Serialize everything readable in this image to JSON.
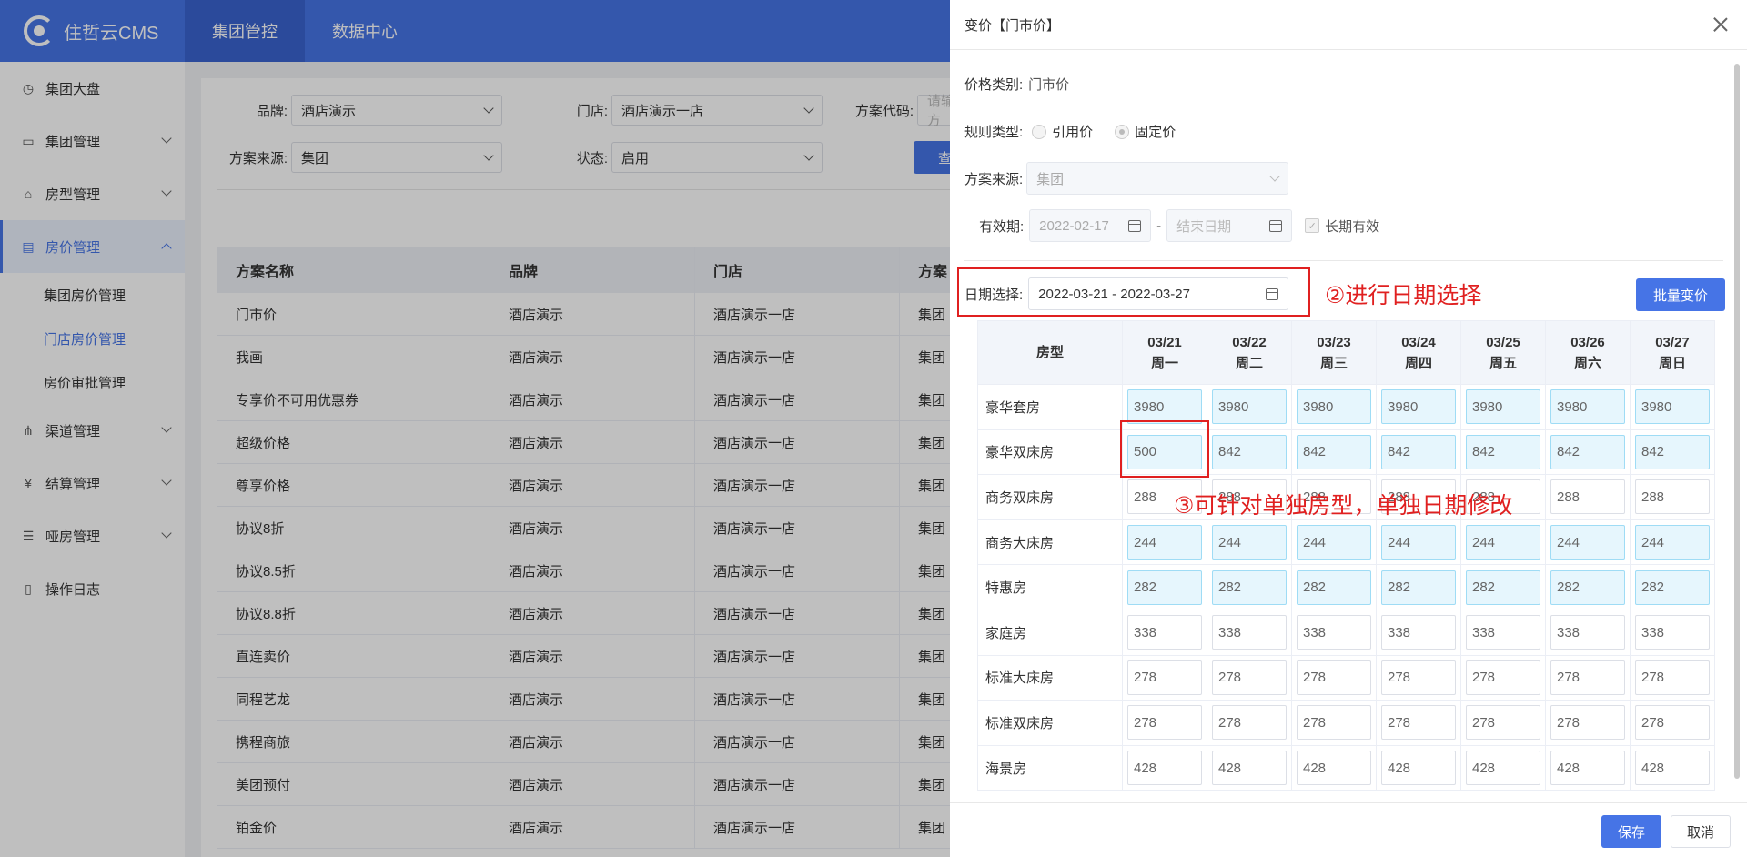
{
  "app": {
    "logo_text": "住哲云CMS"
  },
  "topnav": [
    {
      "label": "集团管控",
      "active": true
    },
    {
      "label": "数据中心",
      "active": false
    }
  ],
  "sidebar": {
    "items": [
      {
        "label": "集团大盘",
        "icon": "clock-icon"
      },
      {
        "label": "集团管理",
        "icon": "monitor-icon"
      },
      {
        "label": "房型管理",
        "icon": "building-icon"
      },
      {
        "label": "房价管理",
        "icon": "price-icon"
      },
      {
        "label": "渠道管理",
        "icon": "network-icon"
      },
      {
        "label": "结算管理",
        "icon": "yen-icon"
      },
      {
        "label": "哑房管理",
        "icon": "list-icon"
      },
      {
        "label": "操作日志",
        "icon": "document-icon"
      }
    ],
    "sub": [
      "集团房价管理",
      "门店房价管理",
      "房价审批管理"
    ]
  },
  "filters": {
    "brand_label": "品牌:",
    "brand_value": "酒店演示",
    "store_label": "门店:",
    "store_value": "酒店演示一店",
    "code_label": "方案代码:",
    "code_placeholder": "请输入方",
    "source_label": "方案来源:",
    "source_value": "集团",
    "status_label": "状态:",
    "status_value": "启用",
    "query_label": "查询"
  },
  "table": {
    "headers": [
      "方案名称",
      "品牌",
      "门店",
      "方案"
    ],
    "rows": [
      [
        "门市价",
        "酒店演示",
        "酒店演示一店",
        "集团"
      ],
      [
        "我画",
        "酒店演示",
        "酒店演示一店",
        "集团"
      ],
      [
        "专享价不可用优惠券",
        "酒店演示",
        "酒店演示一店",
        "集团"
      ],
      [
        "超级价格",
        "酒店演示",
        "酒店演示一店",
        "集团"
      ],
      [
        "尊享价格",
        "酒店演示",
        "酒店演示一店",
        "集团"
      ],
      [
        "协议8折",
        "酒店演示",
        "酒店演示一店",
        "集团"
      ],
      [
        "协议8.5折",
        "酒店演示",
        "酒店演示一店",
        "集团"
      ],
      [
        "协议8.8折",
        "酒店演示",
        "酒店演示一店",
        "集团"
      ],
      [
        "直连卖价",
        "酒店演示",
        "酒店演示一店",
        "集团"
      ],
      [
        "同程艺龙",
        "酒店演示",
        "酒店演示一店",
        "集团"
      ],
      [
        "携程商旅",
        "酒店演示",
        "酒店演示一店",
        "集团"
      ],
      [
        "美团预付",
        "酒店演示",
        "酒店演示一店",
        "集团"
      ],
      [
        "铂金价",
        "酒店演示",
        "酒店演示一店",
        "集团"
      ]
    ]
  },
  "drawer": {
    "title": "变价【门市价】",
    "price_type_label": "价格类别:",
    "price_type_value": "门市价",
    "rule_type_label": "规则类型:",
    "rule_opt1": "引用价",
    "rule_opt2": "固定价",
    "source_label": "方案来源:",
    "source_value": "集团",
    "valid_label": "有效期:",
    "valid_start": "2022-02-17",
    "valid_sep": "-",
    "valid_end_placeholder": "结束日期",
    "long_term_label": "长期有效",
    "date_label": "日期选择:",
    "date_value": "2022-03-21 - 2022-03-27",
    "annotation_date": "②进行日期选择",
    "annotation_cell": "③可针对单独房型，单独日期修改",
    "batch_label": "批量变价",
    "grid": {
      "roomtype_header": "房型",
      "days": [
        {
          "date": "03/21",
          "week": "周一"
        },
        {
          "date": "03/22",
          "week": "周二"
        },
        {
          "date": "03/23",
          "week": "周三"
        },
        {
          "date": "03/24",
          "week": "周四"
        },
        {
          "date": "03/25",
          "week": "周五"
        },
        {
          "date": "03/26",
          "week": "周六"
        },
        {
          "date": "03/27",
          "week": "周日"
        }
      ],
      "rows": [
        {
          "name": "豪华套房",
          "prices": [
            "3980",
            "3980",
            "3980",
            "3980",
            "3980",
            "3980",
            "3980"
          ],
          "highlight": true
        },
        {
          "name": "豪华双床房",
          "prices": [
            "500",
            "842",
            "842",
            "842",
            "842",
            "842",
            "842"
          ],
          "highlight": true
        },
        {
          "name": "商务双床房",
          "prices": [
            "288",
            "288",
            "288",
            "288",
            "288",
            "288",
            "288"
          ],
          "highlight": false
        },
        {
          "name": "商务大床房",
          "prices": [
            "244",
            "244",
            "244",
            "244",
            "244",
            "244",
            "244"
          ],
          "highlight": true
        },
        {
          "name": "特惠房",
          "prices": [
            "282",
            "282",
            "282",
            "282",
            "282",
            "282",
            "282"
          ],
          "highlight": true
        },
        {
          "name": "家庭房",
          "prices": [
            "338",
            "338",
            "338",
            "338",
            "338",
            "338",
            "338"
          ],
          "highlight": false
        },
        {
          "name": "标准大床房",
          "prices": [
            "278",
            "278",
            "278",
            "278",
            "278",
            "278",
            "278"
          ],
          "highlight": false
        },
        {
          "name": "标准双床房",
          "prices": [
            "278",
            "278",
            "278",
            "278",
            "278",
            "278",
            "278"
          ],
          "highlight": false
        },
        {
          "name": "海景房",
          "prices": [
            "428",
            "428",
            "428",
            "428",
            "428",
            "428",
            "428"
          ],
          "highlight": false
        }
      ]
    },
    "save_label": "保存",
    "cancel_label": "取消"
  },
  "colors": {
    "primary": "#4674e6",
    "annotation": "#e02020",
    "highlight_cell": "#e6f6fd"
  }
}
